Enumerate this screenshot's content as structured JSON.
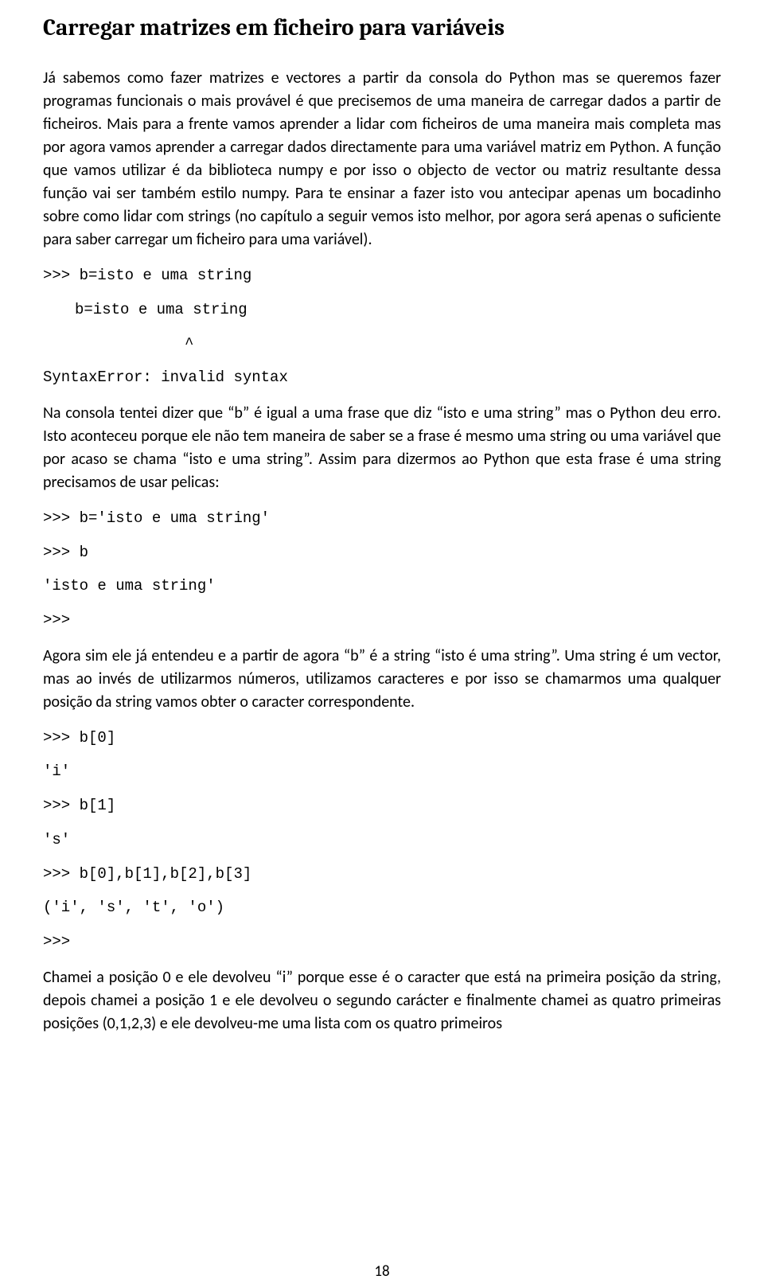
{
  "heading": "Carregar matrizes em ficheiro para variáveis",
  "para1": "Já sabemos como fazer matrizes e vectores a partir da consola do Python mas se queremos fazer programas funcionais o mais provável é que precisemos de uma maneira de carregar dados a partir de ficheiros. Mais para a frente vamos aprender a lidar com ficheiros de uma maneira mais completa mas por agora vamos aprender a carregar dados directamente para uma variável matriz em Python. A função que vamos utilizar é da biblioteca numpy e por isso o objecto de vector ou matriz resultante dessa função vai ser também estilo numpy. Para te ensinar a fazer isto vou antecipar apenas um bocadinho sobre como lidar com strings (no capítulo a seguir vemos isto melhor, por agora será apenas o suficiente para saber carregar um ficheiro para uma variável).",
  "code1_line1": ">>> b=isto e uma string",
  "code1_line2": "b=isto e uma string",
  "code1_line3": "^",
  "code1_line4": "SyntaxError: invalid syntax",
  "para2": "Na consola tentei dizer que “b” é igual a uma frase que diz “isto e uma string” mas o Python deu erro. Isto aconteceu porque ele não tem maneira de saber se a frase é mesmo uma string ou uma variável que por acaso se chama “isto e uma string”. Assim para dizermos ao Python que esta frase é uma string precisamos de usar pelicas:",
  "code2_line1": ">>> b='isto e uma string'",
  "code2_line2": ">>> b",
  "code2_line3": "'isto e uma string'",
  "code2_line4": ">>>",
  "para3": "Agora sim ele já entendeu e a partir de agora “b” é a string “isto é uma string”. Uma string é um vector, mas ao invés de utilizarmos números, utilizamos caracteres e por isso se chamarmos uma qualquer posição da string vamos obter o caracter correspondente.",
  "code3_line1": ">>> b[0]",
  "code3_line2": "'i'",
  "code3_line3": ">>> b[1]",
  "code3_line4": "'s'",
  "code3_line5": ">>> b[0],b[1],b[2],b[3]",
  "code3_line6": "('i', 's', 't', 'o')",
  "code3_line7": ">>>",
  "para4": "Chamei a posição 0 e ele devolveu “i” porque esse é o caracter que está na primeira posição da string, depois chamei a posição 1 e ele devolveu o segundo carácter e finalmente chamei as quatro primeiras posições (0,1,2,3) e ele devolveu-me uma lista com os quatro primeiros",
  "page_number": "18"
}
